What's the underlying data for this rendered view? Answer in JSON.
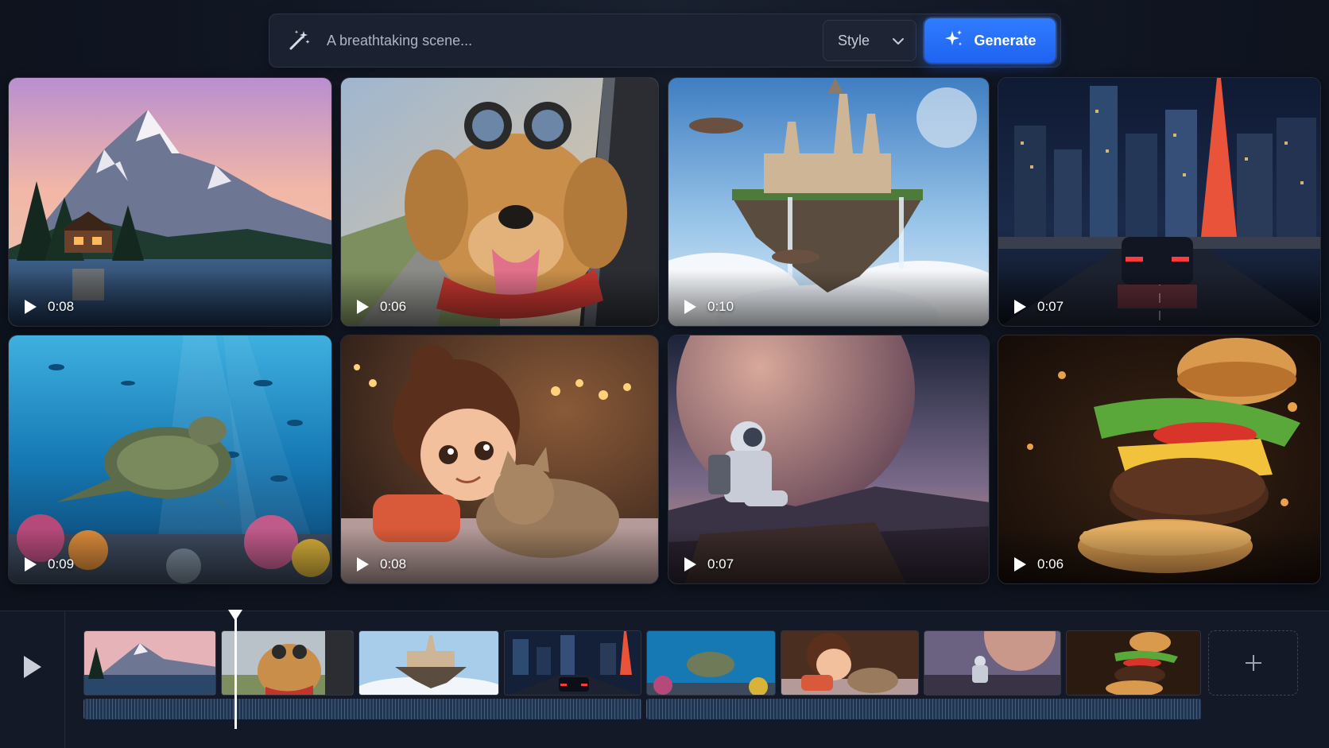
{
  "prompt": {
    "placeholder": "A breathtaking scene...",
    "style_label": "Style",
    "generate_label": "Generate",
    "accent": "#2f7cff"
  },
  "gallery": {
    "tiles": [
      {
        "scene": "mountain-lake",
        "duration": "0:08"
      },
      {
        "scene": "dog-in-car",
        "duration": "0:06"
      },
      {
        "scene": "floating-castle",
        "duration": "0:10"
      },
      {
        "scene": "city-night-car",
        "duration": "0:07"
      },
      {
        "scene": "sea-turtle-reef",
        "duration": "0:09"
      },
      {
        "scene": "girl-and-cat",
        "duration": "0:08"
      },
      {
        "scene": "astronaut-planet",
        "duration": "0:07"
      },
      {
        "scene": "flying-burger",
        "duration": "0:06"
      }
    ]
  },
  "timeline": {
    "clips": [
      "mountain-lake",
      "dog-in-car",
      "floating-castle",
      "city-night-car",
      "sea-turtle-reef",
      "girl-and-cat",
      "astronaut-planet",
      "flying-burger"
    ],
    "icons": {
      "play": "play-icon",
      "add": "plus-icon"
    }
  }
}
